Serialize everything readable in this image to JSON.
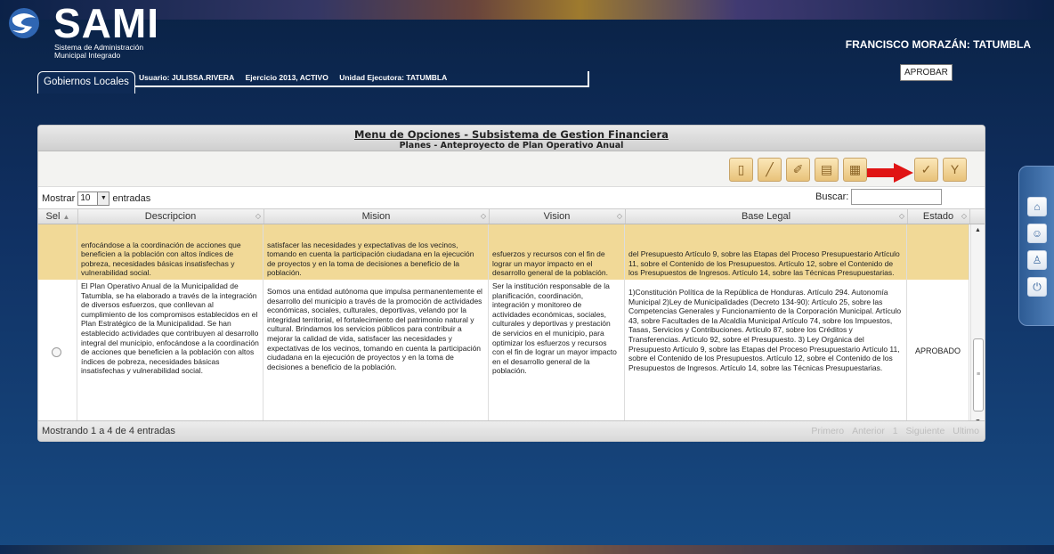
{
  "header": {
    "logo": "SAMI",
    "logo_sub_line1": "Sistema de Administración",
    "logo_sub_line2": "Municipal Integrado",
    "entity": "FRANCISCO MORAZÁN: TATUMBLA"
  },
  "tabs": {
    "active": "Gobiernos Locales",
    "usuario": "Usuario: JULISSA.RIVERA",
    "ejercicio": "Ejercicio 2013, ACTIVO",
    "unidad": "Unidad Ejecutora: TATUMBLA"
  },
  "panel": {
    "title": "Menu de Opciones - Subsistema de Gestion Financiera",
    "subtitle": "Planes - Anteproyecto de Plan Operativo Anual"
  },
  "toolbar": {
    "buttons": [
      "new-icon",
      "edit-icon",
      "erase-icon",
      "detail-icon",
      "report-icon",
      "approve-icon",
      "filter-icon"
    ],
    "tooltip": "APROBAR",
    "accent": "#e8c27a"
  },
  "table": {
    "mostrar_label": "Mostrar",
    "page_length": "10",
    "entradas_label": "entradas",
    "buscar_label": "Buscar:",
    "columns": [
      "Sel",
      "Descripcion",
      "Mision",
      "Vision",
      "Base Legal",
      "Estado"
    ],
    "rows": [
      {
        "descripcion": "enfocándose a la coordinación de acciones que beneficien a la población con altos índices de pobreza, necesidades básicas insatisfechas y vulnerabilidad social.",
        "mision": "satisfacer las necesidades y expectativas de los vecinos, tomando en cuenta la participación ciudadana en la ejecución de proyectos y en la toma de decisiones a beneficio de la población.",
        "vision": "esfuerzos y recursos con el fin de lograr un mayor impacto en el desarrollo general de la población.",
        "base_legal": "del Presupuesto Artículo 9, sobre las Etapas del Proceso Presupuestario Artículo 11, sobre el Contenido de los Presupuestos. Artículo 12, sobre el Contenido de los Presupuestos de Ingresos. Artículo 14, sobre las Técnicas Presupuestarias.",
        "estado": ""
      },
      {
        "descripcion": "El Plan Operativo Anual de la Municipalidad de Tatumbla, se ha elaborado a través de la integración de diversos esfuerzos, que conllevan al cumplimiento de los compromisos establecidos en el Plan Estratégico de la Municipalidad. Se han establecido actividades que contribuyen al desarrollo integral del municipio, enfocándose a la coordinación de acciones que beneficien a la población con altos índices de pobreza, necesidades básicas insatisfechas y vulnerabilidad social.",
        "mision": "Somos una entidad autónoma que impulsa permanentemente el desarrollo del municipio a través de la promoción de actividades económicas, sociales, culturales, deportivas, velando por la integridad territorial, el fortalecimiento del patrimonio natural y cultural. Brindamos los servicios públicos para contribuir a mejorar la calidad de vida, satisfacer las necesidades y expectativas de los vecinos, tomando en cuenta la participación ciudadana en la ejecución de proyectos y en la toma de decisiones a beneficio de la población.",
        "vision": "Ser la institución responsable de la planificación, coordinación, integración y monitoreo de actividades económicas, sociales, culturales y deportivas y prestación de servicios en el municipio, para optimizar los esfuerzos y recursos con el fin de lograr un mayor impacto en el desarrollo general de la población.",
        "base_legal": "1)Constitución Política de la República de Honduras. Artículo 294. Autonomía Municipal 2)Ley de Municipalidades (Decreto 134-90): Artículo 25, sobre las Competencias Generales y Funcionamiento de la Corporación Municipal. Artículo 43, sobre Facultades de la Alcaldía Municipal Artículo 74, sobre los Impuestos, Tasas, Servicios y Contribuciones. Artículo 87, sobre los Créditos y Transferencias. Artículo 92, sobre el Presupuesto. 3) Ley Orgánica del Presupuesto Artículo 9, sobre las Etapas del Proceso Presupuestario Artículo 11, sobre el Contenido de los Presupuestos. Artículo 12, sobre el Contenido de los Presupuestos de Ingresos. Artículo 14, sobre las Técnicas Presupuestarias.",
        "estado": "APROBADO"
      }
    ],
    "info": "Mostrando 1 a 4 de 4 entradas",
    "pager": [
      "Primero",
      "Anterior",
      "1",
      "Siguiente",
      "Ultimo"
    ]
  },
  "sidedock": [
    "home-icon",
    "users-icon",
    "badge-icon",
    "power-icon"
  ]
}
